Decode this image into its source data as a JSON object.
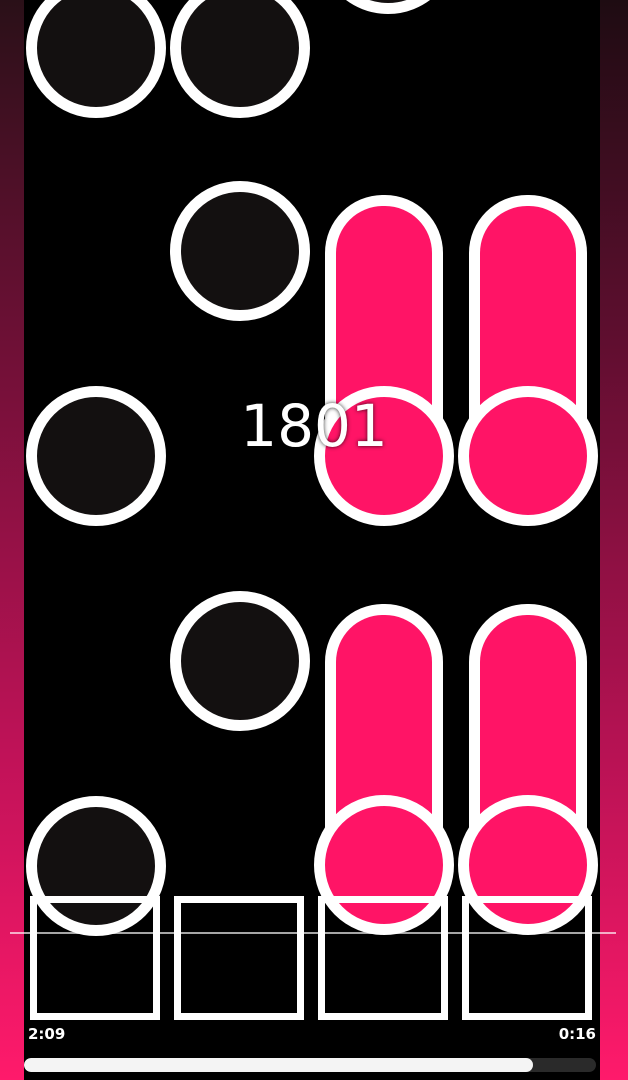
{
  "score": "1801",
  "time_elapsed": "2:09",
  "time_remaining": "0:16",
  "song_progress": 0.89,
  "colors": {
    "note_fill": "#131010",
    "note_outline": "#ffffff",
    "hold_fill": "#ff1466",
    "background": "#000000",
    "side_gradient": "#ff1a6b"
  },
  "lanes": [
    "lane-1",
    "lane-2",
    "lane-3",
    "lane-4"
  ]
}
